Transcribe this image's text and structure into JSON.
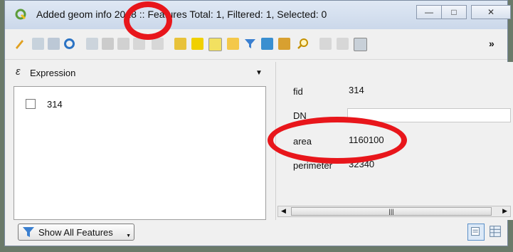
{
  "window": {
    "title": "Added geom info 2018 :: Features Total: 1, Filtered: 1, Selected: 0",
    "min_symbol": "—",
    "max_symbol": "□",
    "close_symbol": "✕"
  },
  "toolbar": {
    "overflow": "»",
    "icons": [
      "edit-pencil-icon",
      "toggle-edit-icon",
      "save-icon",
      "reload-icon",
      "add-feature-icon",
      "delete-icon",
      "cut-icon",
      "copy-icon",
      "paste-icon",
      "expression-select-icon",
      "select-all-icon",
      "invert-selection-icon",
      "deselect-icon",
      "filter-icon",
      "move-top-icon",
      "pan-to-icon",
      "zoom-to-icon",
      "copy-rows-icon",
      "paste-rows-icon",
      "field-calculator-icon"
    ]
  },
  "filter": {
    "icon": "expression-icon",
    "label": "Expression"
  },
  "features": [
    {
      "label": "314",
      "checked": false
    }
  ],
  "form": {
    "fields": [
      {
        "label": "fid",
        "value": "314"
      },
      {
        "label": "DN",
        "value": ""
      },
      {
        "label": "area",
        "value": "1160100"
      },
      {
        "label": "perimeter",
        "value": "32340"
      }
    ]
  },
  "bottom": {
    "show_all_label": "Show All Features"
  },
  "colors": {
    "annotation": "#e8161b",
    "qgis_green": "#5c9c3a"
  }
}
